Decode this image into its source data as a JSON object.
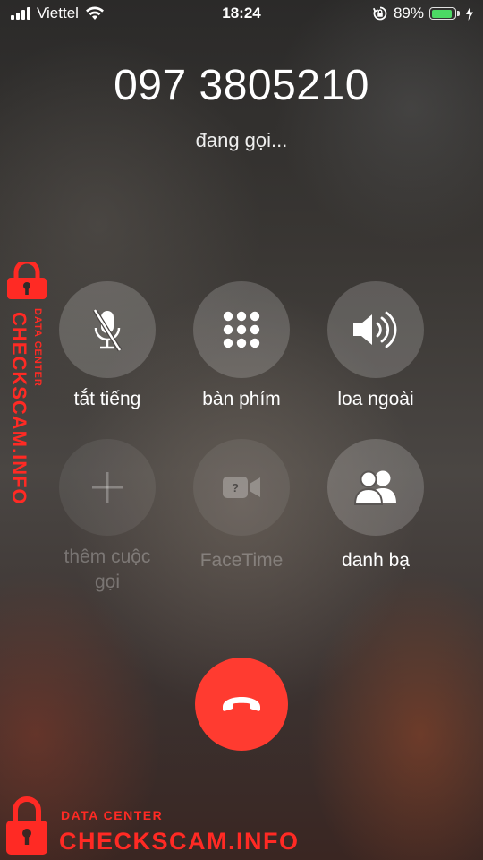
{
  "status_bar": {
    "carrier": "Viettel",
    "time": "18:24",
    "battery_percent": "89%",
    "battery_level": 0.89,
    "signal_bars": 4,
    "icons": [
      "signal-icon",
      "wifi-icon",
      "rotation-lock-icon",
      "battery-icon",
      "charging-bolt-icon"
    ]
  },
  "call": {
    "number": "097 3805210",
    "status": "đang gọi..."
  },
  "controls": [
    {
      "label": "tắt tiếng",
      "icon": "mute-microphone-icon",
      "enabled": true
    },
    {
      "label": "bàn phím",
      "icon": "keypad-icon",
      "enabled": true
    },
    {
      "label": "loa ngoài",
      "icon": "speaker-icon",
      "enabled": true
    },
    {
      "label": "thêm cuộc gọi",
      "icon": "add-call-icon",
      "enabled": false
    },
    {
      "label": "FaceTime",
      "icon": "facetime-icon",
      "enabled": false
    },
    {
      "label": "danh bạ",
      "icon": "contacts-icon",
      "enabled": true
    }
  ],
  "end_call": {
    "icon": "end-call-icon",
    "color": "#ff3b30"
  },
  "watermark": {
    "small": "DATA CENTER",
    "main": "CHECKSCAM.INFO",
    "color": "#ff2a24"
  }
}
